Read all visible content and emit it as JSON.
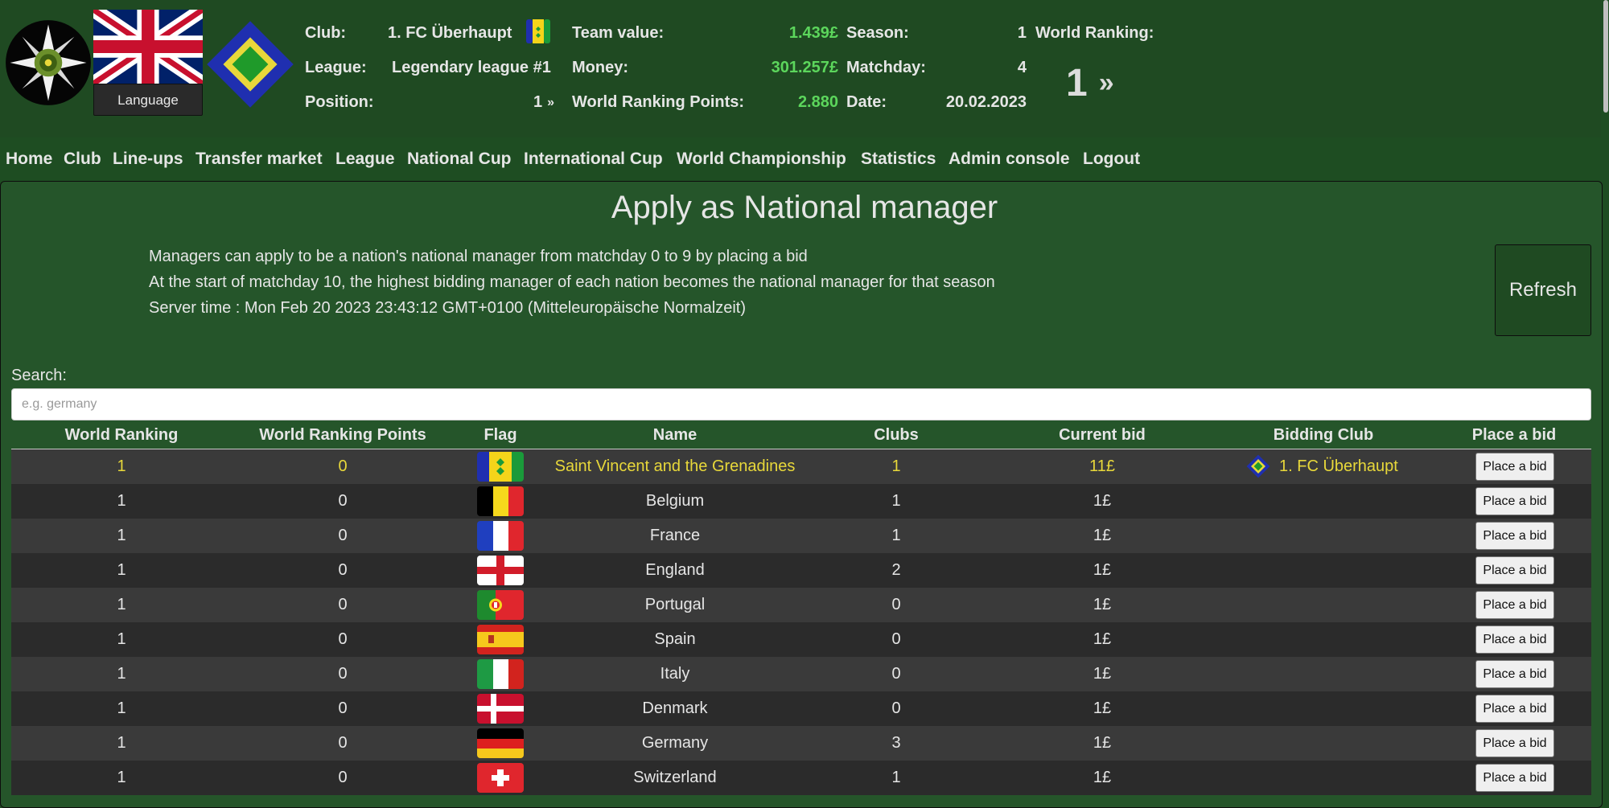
{
  "header": {
    "language_label": "Language",
    "club_label": "Club:",
    "club_value": "1. FC Überhaupt",
    "league_label": "League:",
    "league_value": "Legendary league #1",
    "position_label": "Position:",
    "position_value": "1",
    "team_value_label": "Team value:",
    "team_value_value": "1.439£",
    "money_label": "Money:",
    "money_value": "301.257£",
    "wrp_label": "World Ranking Points:",
    "wrp_value": "2.880",
    "season_label": "Season:",
    "season_value": "1",
    "matchday_label": "Matchday:",
    "matchday_value": "4",
    "date_label": "Date:",
    "date_value": "20.02.2023",
    "world_ranking_label": "World Ranking:",
    "world_ranking_value": "1",
    "chevron_glyph": "»"
  },
  "nav": [
    "Home",
    "Club",
    "Line-ups",
    "Transfer market",
    "League",
    "National Cup",
    "International Cup",
    "World Championship",
    "Statistics",
    "Admin console",
    "Logout"
  ],
  "main": {
    "title": "Apply as National manager",
    "info": [
      "Managers can apply to be a nation's national manager from matchday 0 to 9 by placing a bid",
      "At the start of matchday 10, the highest bidding manager of each nation becomes the national manager for that season",
      "Server time : Mon Feb 20 2023 23:43:12 GMT+0100 (Mitteleuropäische Normalzeit)"
    ],
    "refresh_label": "Refresh",
    "search_label": "Search:",
    "search_placeholder": "e.g. germany"
  },
  "table": {
    "columns": [
      "World Ranking",
      "World Ranking Points",
      "Flag",
      "Name",
      "Clubs",
      "Current bid",
      "Bidding Club",
      "Place a bid"
    ],
    "bid_button_label": "Place a bid",
    "rows": [
      {
        "rank": "1",
        "points": "0",
        "flag": "saint-vincent-flag",
        "name": "Saint Vincent and the Grenadines",
        "clubs": "1",
        "bid": "11£",
        "bidder": "1. FC Überhaupt",
        "highlight": true
      },
      {
        "rank": "1",
        "points": "0",
        "flag": "belgium-flag",
        "name": "Belgium",
        "clubs": "1",
        "bid": "1£",
        "bidder": ""
      },
      {
        "rank": "1",
        "points": "0",
        "flag": "france-flag",
        "name": "France",
        "clubs": "1",
        "bid": "1£",
        "bidder": ""
      },
      {
        "rank": "1",
        "points": "0",
        "flag": "england-flag",
        "name": "England",
        "clubs": "2",
        "bid": "1£",
        "bidder": ""
      },
      {
        "rank": "1",
        "points": "0",
        "flag": "portugal-flag",
        "name": "Portugal",
        "clubs": "0",
        "bid": "1£",
        "bidder": ""
      },
      {
        "rank": "1",
        "points": "0",
        "flag": "spain-flag",
        "name": "Spain",
        "clubs": "0",
        "bid": "1£",
        "bidder": ""
      },
      {
        "rank": "1",
        "points": "0",
        "flag": "italy-flag",
        "name": "Italy",
        "clubs": "0",
        "bid": "1£",
        "bidder": ""
      },
      {
        "rank": "1",
        "points": "0",
        "flag": "denmark-flag",
        "name": "Denmark",
        "clubs": "0",
        "bid": "1£",
        "bidder": ""
      },
      {
        "rank": "1",
        "points": "0",
        "flag": "germany-flag",
        "name": "Germany",
        "clubs": "3",
        "bid": "1£",
        "bidder": ""
      },
      {
        "rank": "1",
        "points": "0",
        "flag": "switzerland-flag",
        "name": "Switzerland",
        "clubs": "1",
        "bid": "1£",
        "bidder": ""
      }
    ]
  },
  "colors": {
    "background": "#1e4d22",
    "panel": "#25552a",
    "money_green": "#5cd65c",
    "highlight_yellow": "#e8d83a",
    "row_odd": "#3a3a3a",
    "row_even": "#2b2b2b"
  }
}
